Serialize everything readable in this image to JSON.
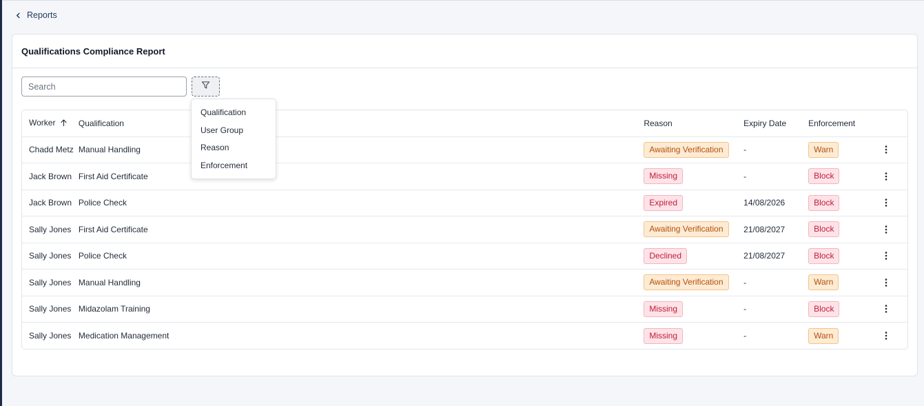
{
  "breadcrumb": {
    "label": "Reports",
    "icon": "chevron-left-icon"
  },
  "card": {
    "title": "Qualifications Compliance Report"
  },
  "search": {
    "placeholder": "Search",
    "value": ""
  },
  "filter": {
    "icon": "filter-icon"
  },
  "table": {
    "headers": {
      "worker": "Worker",
      "qualification": "Qualification",
      "reason": "Reason",
      "expiry": "Expiry Date",
      "enforcement": "Enforcement"
    },
    "sort": {
      "column": "worker",
      "direction": "ascending"
    },
    "rows": [
      {
        "worker": "Chadd Metz",
        "qualification": "Manual Handling",
        "reason": "Awaiting Verification",
        "reason_tone": "warn",
        "expiry": "-",
        "enforcement": "Warn",
        "enforcement_tone": "warn"
      },
      {
        "worker": "Jack Brown",
        "qualification": "First Aid Certificate",
        "reason": "Missing",
        "reason_tone": "error",
        "expiry": "-",
        "enforcement": "Block",
        "enforcement_tone": "error"
      },
      {
        "worker": "Jack Brown",
        "qualification": "Police Check",
        "reason": "Expired",
        "reason_tone": "error",
        "expiry": "14/08/2026",
        "enforcement": "Block",
        "enforcement_tone": "error"
      },
      {
        "worker": "Sally Jones",
        "qualification": "First Aid Certificate",
        "reason": "Awaiting Verification",
        "reason_tone": "warn",
        "expiry": "21/08/2027",
        "enforcement": "Block",
        "enforcement_tone": "error"
      },
      {
        "worker": "Sally Jones",
        "qualification": "Police Check",
        "reason": "Declined",
        "reason_tone": "error",
        "expiry": "21/08/2027",
        "enforcement": "Block",
        "enforcement_tone": "error"
      },
      {
        "worker": "Sally Jones",
        "qualification": "Manual Handling",
        "reason": "Awaiting Verification",
        "reason_tone": "warn",
        "expiry": "-",
        "enforcement": "Warn",
        "enforcement_tone": "warn"
      },
      {
        "worker": "Sally Jones",
        "qualification": "Midazolam Training",
        "reason": "Missing",
        "reason_tone": "error",
        "expiry": "-",
        "enforcement": "Block",
        "enforcement_tone": "error"
      },
      {
        "worker": "Sally Jones",
        "qualification": "Medication Management",
        "reason": "Missing",
        "reason_tone": "error",
        "expiry": "-",
        "enforcement": "Warn",
        "enforcement_tone": "warn"
      }
    ]
  },
  "filter_menu": {
    "items": [
      "Qualification",
      "User Group",
      "Reason",
      "Enforcement"
    ]
  },
  "colors": {
    "accent": "#1f3a5f",
    "warn_bg": "#fdebd3",
    "warn_text": "#b4500f",
    "error_bg": "#fde3e7",
    "error_text": "#c21a3b"
  }
}
